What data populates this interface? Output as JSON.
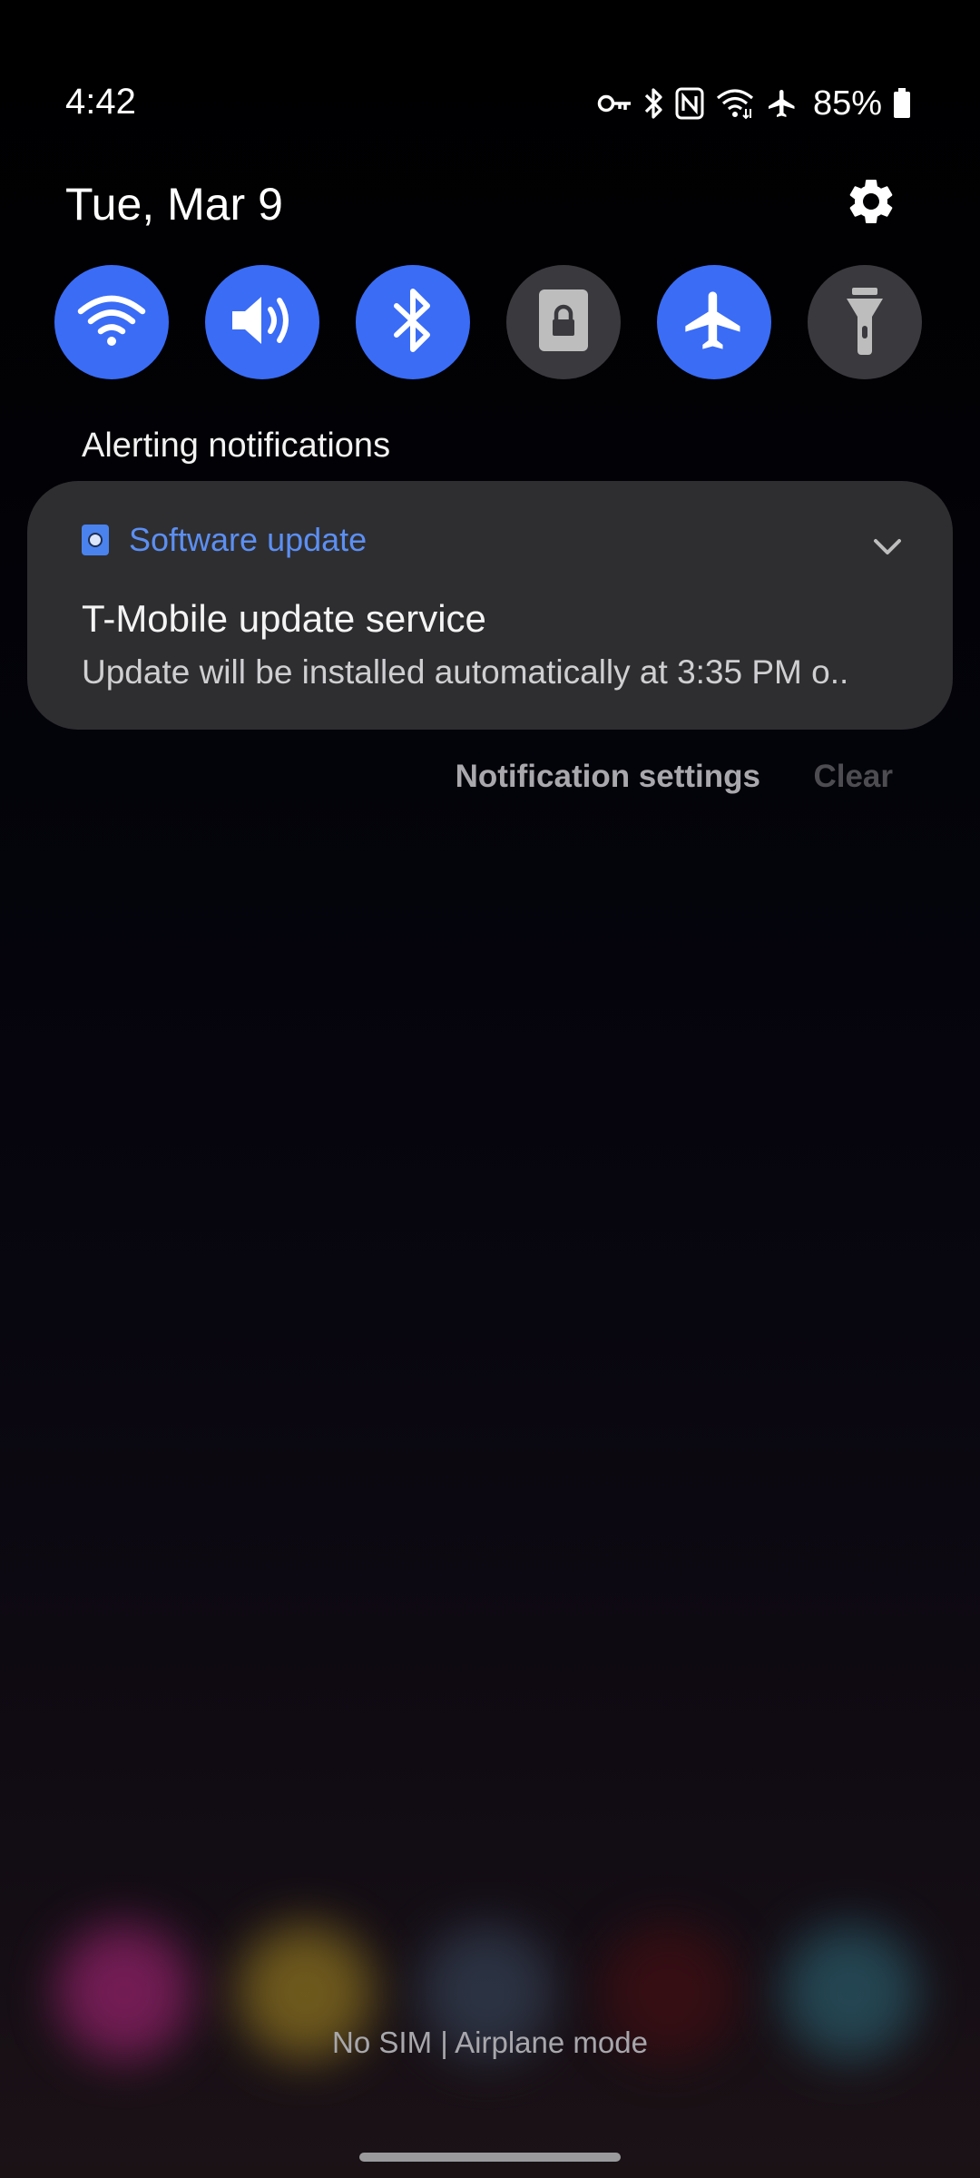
{
  "status_bar": {
    "time": "4:42",
    "battery": "85%",
    "icons": [
      "vpn-key-icon",
      "bluetooth-icon",
      "nfc-icon",
      "wifi-icon",
      "airplane-icon",
      "battery-icon"
    ]
  },
  "header": {
    "date": "Tue, Mar 9",
    "settings_icon": "gear-icon"
  },
  "quick_settings": {
    "accent_color": "#3a6cf6",
    "tiles": [
      {
        "icon": "wifi-icon",
        "state": "on"
      },
      {
        "icon": "sound-icon",
        "state": "on"
      },
      {
        "icon": "bluetooth-icon",
        "state": "on"
      },
      {
        "icon": "rotation-lock-icon",
        "state": "off"
      },
      {
        "icon": "airplane-icon",
        "state": "on"
      },
      {
        "icon": "flashlight-icon",
        "state": "off"
      }
    ]
  },
  "notifications": {
    "section_title": "Alerting notifications",
    "items": [
      {
        "app_name": "Software update",
        "title": "T-Mobile update service",
        "body": "Update will be installed automatically at 3:35 PM o.."
      }
    ],
    "settings_label": "Notification settings",
    "clear_label": "Clear"
  },
  "footer": {
    "carrier_text": "No SIM | Airplane mode"
  }
}
